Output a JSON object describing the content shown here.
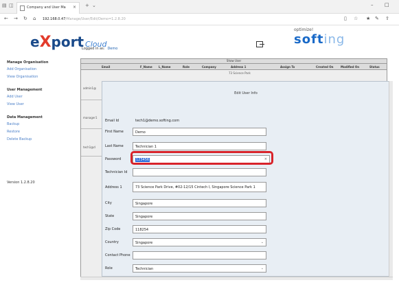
{
  "browser": {
    "tab_title": "Company and User Ma",
    "url_host": "192.168.0.47",
    "url_rest": "/Manage/User/Edit/Demo=1.2.8.20"
  },
  "header": {
    "logo_e": "e",
    "logo_x": "X",
    "logo_port": "port",
    "logo_cloud": "Cloud",
    "logged_in_label": "Logged in as:",
    "logged_in_user": "Demo",
    "brand_tag": "optimize!",
    "brand_main": "soft",
    "brand_fade": "ing"
  },
  "sidebar": {
    "sections": [
      {
        "title": "Manage Organisation",
        "links": [
          "Add Organisation",
          "View Organisation"
        ]
      },
      {
        "title": "User Management",
        "links": [
          "Add User",
          "View User"
        ]
      },
      {
        "title": "Data Management",
        "links": [
          "Backup",
          "Restore",
          "Delete Backup"
        ]
      }
    ],
    "version": "Version 1.2.8.20"
  },
  "table": {
    "toolbar_text": "Show User",
    "columns": [
      "Email",
      "F_Name",
      "L_Name",
      "Role",
      "Company",
      "Address 1",
      "Assign To",
      "Created On",
      "Modified On",
      "Status"
    ],
    "first_address": "73 Science Park",
    "rows": [
      "admin1@",
      "manager1",
      "tech1@d"
    ]
  },
  "modal": {
    "title": "Edit User Info",
    "email_label": "Email Id",
    "email_value": "tech1@demo.softing.com",
    "fields": [
      {
        "label": "First Name",
        "value": "Demo"
      },
      {
        "label": "Last Name",
        "value": "Technician 1"
      },
      {
        "label": "Password",
        "value": "123456"
      },
      {
        "label": "Technician Id",
        "value": ""
      },
      {
        "label": "Address 1",
        "value": "73 Science Park Drive, #02-12/15 Cintech I, Singapore Science Park 1"
      },
      {
        "label": "City",
        "value": "Singapore"
      },
      {
        "label": "State",
        "value": "Singapore"
      },
      {
        "label": "Zip Code",
        "value": "118254"
      },
      {
        "label": "Country",
        "value": "Singapore"
      },
      {
        "label": "Contact Phone",
        "value": ""
      },
      {
        "label": "Role",
        "value": "Technician"
      }
    ]
  }
}
